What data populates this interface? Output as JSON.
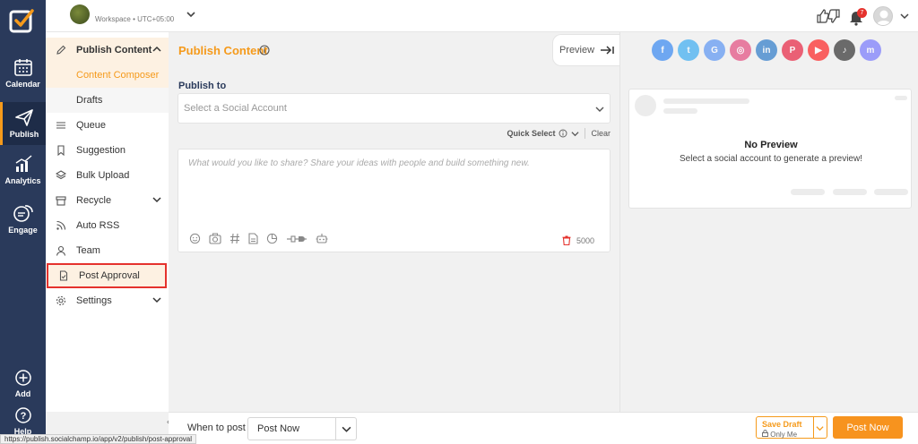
{
  "rail": {
    "items": [
      {
        "label": "Calendar",
        "icon": "calendar-icon"
      },
      {
        "label": "Publish",
        "icon": "paper-plane-icon"
      },
      {
        "label": "Analytics",
        "icon": "analytics-icon"
      },
      {
        "label": "Engage",
        "icon": "chat-icon"
      }
    ],
    "add_label": "Add",
    "help_label": "Help"
  },
  "topbar": {
    "workspace_text": "Workspace • UTC+05:00",
    "notification_count": "7"
  },
  "subnav": {
    "header": "Publish Content",
    "content_composer": "Content Composer",
    "drafts": "Drafts",
    "queue": "Queue",
    "suggestion": "Suggestion",
    "bulk_upload": "Bulk Upload",
    "recycle": "Recycle",
    "auto_rss": "Auto RSS",
    "team": "Team",
    "post_approval": "Post Approval",
    "settings": "Settings"
  },
  "composer": {
    "title": "Publish Content",
    "preview_label": "Preview",
    "publish_to_label": "Publish to",
    "account_placeholder": "Select a Social Account",
    "quick_select_label": "Quick Select",
    "clear_label": "Clear",
    "editor_placeholder": "What would you like to share? Share your ideas with people and build something new.",
    "char_count": "5000"
  },
  "preview": {
    "no_preview_title": "No Preview",
    "no_preview_sub": "Select a social account to generate a preview!",
    "networks": [
      {
        "name": "facebook-icon",
        "color": "#1877f2",
        "glyph": "f"
      },
      {
        "name": "twitter-icon",
        "color": "#1da1f2",
        "glyph": "t"
      },
      {
        "name": "google-business-icon",
        "color": "#4285f4",
        "glyph": "G"
      },
      {
        "name": "instagram-icon",
        "color": "#e1306c",
        "glyph": "◎"
      },
      {
        "name": "linkedin-icon",
        "color": "#0a66c2",
        "glyph": "in"
      },
      {
        "name": "pinterest-icon",
        "color": "#e60023",
        "glyph": "P"
      },
      {
        "name": "youtube-icon",
        "color": "#ff0000",
        "glyph": "▶"
      },
      {
        "name": "tiktok-icon",
        "color": "#111111",
        "glyph": "♪"
      },
      {
        "name": "mastodon-icon",
        "color": "#6364ff",
        "glyph": "m"
      }
    ]
  },
  "bottom": {
    "when_label": "When to post",
    "when_value": "Post Now",
    "save_draft": "Save Draft",
    "only_me": "Only Me",
    "post_now": "Post Now"
  },
  "status_url": "https://publish.socialchamp.io/app/v2/publish/post-approval",
  "colors": {
    "accent": "#f59a1b",
    "rail": "#2a3a5b",
    "highlight": "#e5322d"
  }
}
